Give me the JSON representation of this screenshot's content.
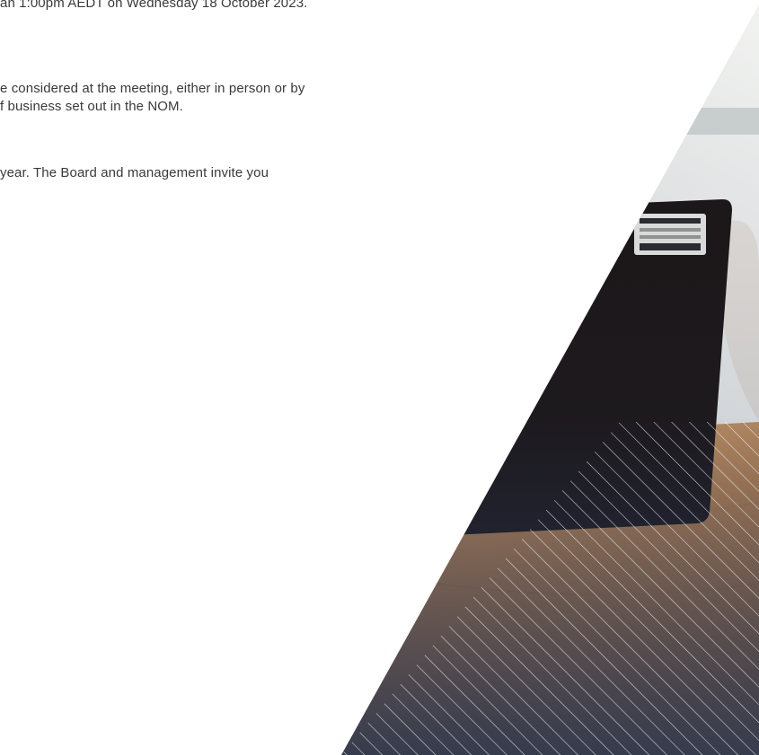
{
  "document": {
    "lines": [
      "an 1:00pm AEDT on Wednesday 18 October 2023.",
      "e considered at the meeting, either in person or by",
      "f business set out in the NOM.",
      "year. The Board and management invite you"
    ]
  },
  "image": {
    "description_icon": "laptop-photo",
    "colors": {
      "wood_light": "#c9955f",
      "wood_dark": "#8a5a35",
      "wall": "#e7e9e6",
      "laptop": "#1a1312",
      "overlay_navy": "#2a3a5c"
    }
  }
}
